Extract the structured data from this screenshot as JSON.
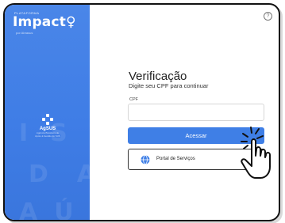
{
  "brand": {
    "kicker": "PLATAFORMA",
    "name": "Impact",
    "tagline": "por Abrasus"
  },
  "watermark": {
    "row1": "ISTE",
    "row2": "DA",
    "row3": "AÚD"
  },
  "partner": {
    "label": "AgSUS",
    "sublabel": "Agência Brasileira de Apoio à Gestão do SUS"
  },
  "form": {
    "title": "Verificação",
    "subtitle": "Digite seu CPF para continuar",
    "cpf_label": "CPF",
    "cpf_value": "",
    "submit_label": "Acessar",
    "portal_label": "Portal de Serviços"
  },
  "colors": {
    "primary": "#3f7fe6",
    "panel": "#4a86e8"
  }
}
